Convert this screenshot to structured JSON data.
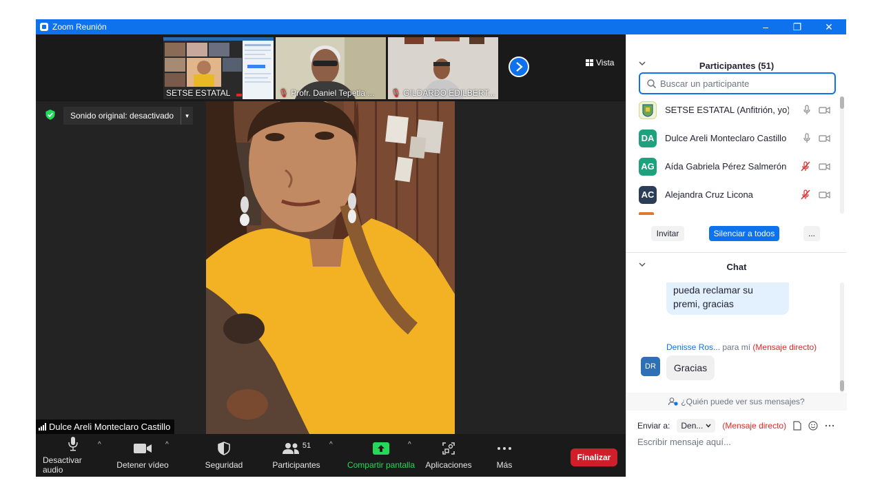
{
  "window": {
    "title": "Zoom Reunión",
    "controls": [
      "–",
      "❐",
      "✕"
    ]
  },
  "thumbnails": [
    {
      "name": "SETSE ESTATAL",
      "muted": false
    },
    {
      "name": "Profr. Daniel Tepetla ...",
      "muted": true
    },
    {
      "name": "GILDARDO EDILBERT...",
      "muted": true
    }
  ],
  "view_button": "Vista",
  "sound_original": "Sonido original: desactivado",
  "active_speaker": "Dulce Areli Monteclaro Castillo",
  "toolbar": {
    "mute_audio": "Desactivar audio",
    "stop_video": "Detener vídeo",
    "security": "Seguridad",
    "participants": "Participantes",
    "participant_count": "51",
    "share_screen": "Compartir pantalla",
    "apps": "Aplicaciones",
    "more": "Más",
    "end": "Finalizar"
  },
  "participants_panel": {
    "title": "Participantes (51)",
    "search_placeholder": "Buscar un participante",
    "list": [
      {
        "initials": "",
        "name": "SETSE ESTATAL (Anfitrión, yo)",
        "color": "#c9d9a0",
        "mic_muted": false
      },
      {
        "initials": "DA",
        "name": "Dulce Areli Monteclaro Castillo",
        "color": "#1ea27d",
        "mic_muted": false
      },
      {
        "initials": "AG",
        "name": "Aída Gabriela Pérez Salmerón",
        "color": "#1ea27d",
        "mic_muted": true
      },
      {
        "initials": "AC",
        "name": "Alejandra Cruz Licona",
        "color": "#2c3e57",
        "mic_muted": true
      }
    ],
    "invite": "Invitar",
    "mute_all": "Silenciar a todos",
    "more": "..."
  },
  "chat_panel": {
    "title": "Chat",
    "messages": [
      {
        "text_lines": [
          "pueda reclamar su",
          "premi, gracias"
        ]
      },
      {
        "sender": "Denisse Ros...",
        "to": "para mí",
        "direct": "(Mensaje directo)",
        "avatar": "DR",
        "text": "Gracias"
      }
    ],
    "who_can_see": "¿Quién puede ver sus mensajes?",
    "send_to_label": "Enviar a:",
    "send_to_value": "Den...",
    "send_to_direct": "(Mensaje directo)",
    "input_placeholder": "Escribir mensaje aquí..."
  },
  "colors": {
    "zoom_blue": "#0e72ed",
    "end_red": "#cf1f2a",
    "share_green": "#23d959",
    "direct_red": "#e02828"
  }
}
